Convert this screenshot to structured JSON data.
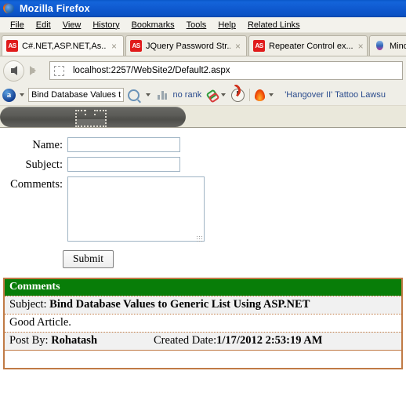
{
  "window": {
    "title": "Mozilla Firefox",
    "icon": "firefox-icon"
  },
  "menubar": {
    "items": [
      {
        "label": "File",
        "accel": "F"
      },
      {
        "label": "Edit",
        "accel": "E"
      },
      {
        "label": "View",
        "accel": "V"
      },
      {
        "label": "History",
        "accel": "s"
      },
      {
        "label": "Bookmarks",
        "accel": "B"
      },
      {
        "label": "Tools",
        "accel": "T"
      },
      {
        "label": "Help",
        "accel": "H"
      },
      {
        "label": "Related Links",
        "accel": "R"
      }
    ]
  },
  "tabs": [
    {
      "label": "C#.NET,ASP.NET,As...",
      "favicon": "asp-net-favicon",
      "close": "×",
      "active": true
    },
    {
      "label": "JQuery Password Str...",
      "favicon": "asp-net-favicon",
      "close": "×",
      "active": false
    },
    {
      "label": "Repeater Control ex...",
      "favicon": "asp-net-favicon",
      "close": "×",
      "active": false
    },
    {
      "label": "Mindcra",
      "favicon": "mindcra-favicon",
      "close": "",
      "active": false
    }
  ],
  "navbar": {
    "back_icon": "back-arrow-icon",
    "forward_icon": "forward-arrow-icon",
    "url": "localhost:2257/WebSite2/Default2.aspx",
    "site_icon": "blank-favicon"
  },
  "alexa_toolbar": {
    "logo": "alexa-logo-icon",
    "search_value": "Bind Database Values to",
    "search_icon": "magnifier-icon",
    "rank_icon": "bar-chart-icon",
    "rank_text": "no rank",
    "links_icon": "link-icon",
    "traffic_icon": "speedometer-icon",
    "hot_icon": "flame-icon",
    "news_text": "'Hangover II' Tattoo Lawsu"
  },
  "page": {
    "banner": {
      "image_alt_icon": "broken-image-icon"
    },
    "form": {
      "name": {
        "label": "Name:",
        "value": "",
        "placeholder": ""
      },
      "subject": {
        "label": "Subject:",
        "value": "",
        "placeholder": ""
      },
      "comments": {
        "label": "Comments:",
        "value": "",
        "placeholder": ""
      },
      "submit_label": "Submit"
    },
    "comments_table": {
      "header": "Comments",
      "rows": [
        {
          "type": "subject",
          "label": "Subject: ",
          "value": "Bind Database Values to Generic List Using ASP.NET"
        },
        {
          "type": "body",
          "label": "",
          "value": "Good Article."
        },
        {
          "type": "meta",
          "label": "Post By: ",
          "value": "Rohatash",
          "label2": "Created Date:",
          "value2": "1/17/2012 2:53:19 AM"
        }
      ]
    }
  },
  "colors": {
    "titlebar": "#0f5ad0",
    "table_header_green": "#087d08",
    "table_border": "#c07a45",
    "link_blue": "#2a4b8d",
    "banner_dark": "#5b5b57",
    "page_bg": "#ffffff"
  }
}
